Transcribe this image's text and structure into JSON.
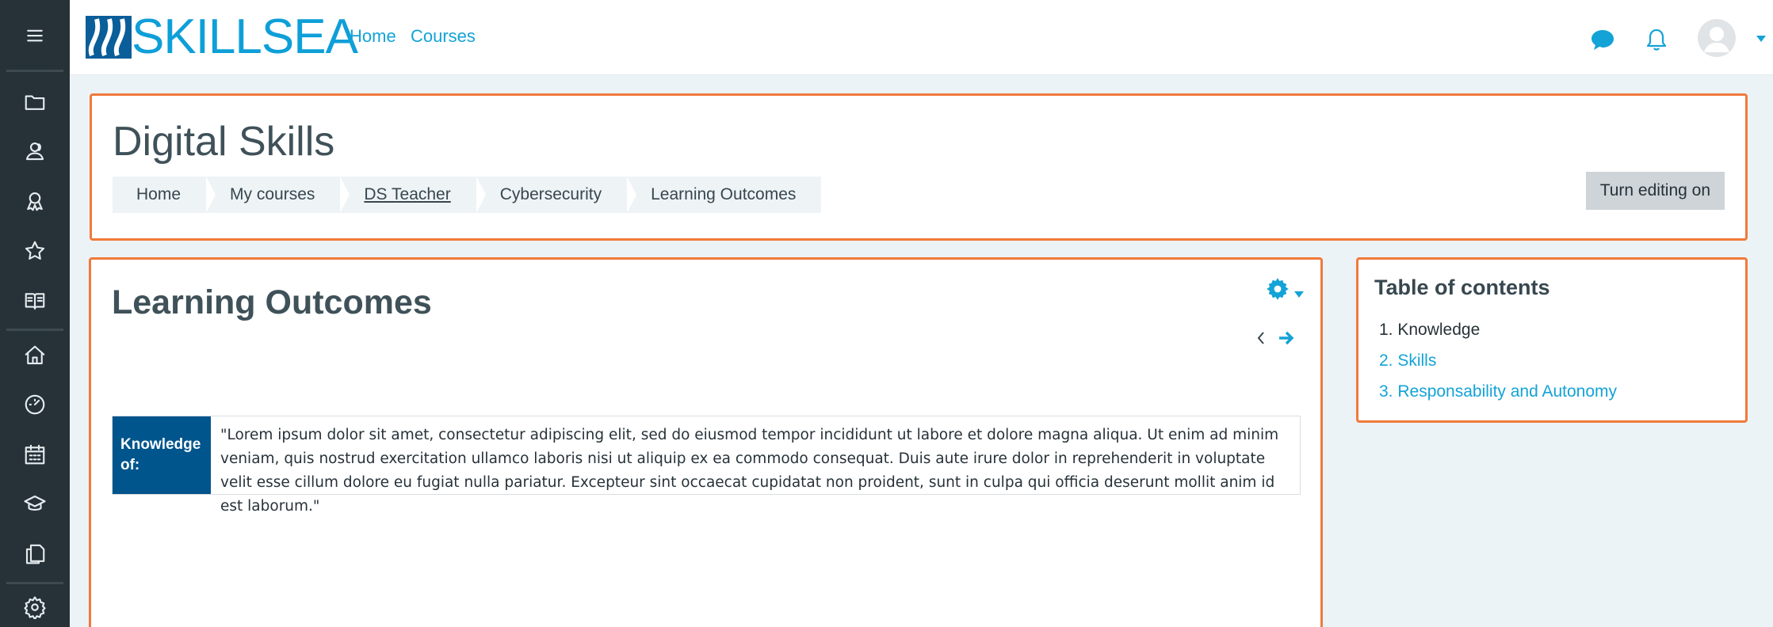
{
  "navbar": {
    "logo_text": "SKILLSEA",
    "links": [
      "Home",
      "Courses"
    ]
  },
  "sidebar": {
    "icons": [
      "menu-icon",
      "folder-icon",
      "users-icon",
      "badge-icon",
      "star-icon",
      "book-icon",
      "home-icon",
      "dashboard-icon",
      "calendar-icon",
      "graduation-icon",
      "files-icon",
      "settings-icon"
    ]
  },
  "header": {
    "title": "Digital Skills",
    "breadcrumbs": [
      "Home",
      "My courses",
      "DS Teacher",
      "Cybersecurity",
      "Learning Outcomes"
    ],
    "edit_button": "Turn editing on"
  },
  "main": {
    "title": "Learning Outcomes",
    "table": {
      "header": "Knowledge of:",
      "text": "\"Lorem ipsum dolor sit amet, consectetur adipiscing elit, sed do eiusmod tempor incididunt ut labore et dolore magna aliqua. Ut enim ad minim veniam, quis nostrud exercitation ullamco laboris nisi ut aliquip ex ea commodo consequat. Duis aute irure dolor in reprehenderit in voluptate velit esse cillum dolore eu fugiat nulla pariatur. Excepteur sint occaecat cupidatat non proident, sunt in culpa qui officia deserunt mollit anim id est laborum.\""
    }
  },
  "toc": {
    "title": "Table of contents",
    "items": [
      "1. Knowledge",
      "2. Skills",
      "3. Responsability and Autonomy"
    ]
  },
  "colors": {
    "accent": "#13a3d6",
    "card_border": "#f07a3a",
    "sidebar": "#263238",
    "table_header": "#00558d"
  }
}
